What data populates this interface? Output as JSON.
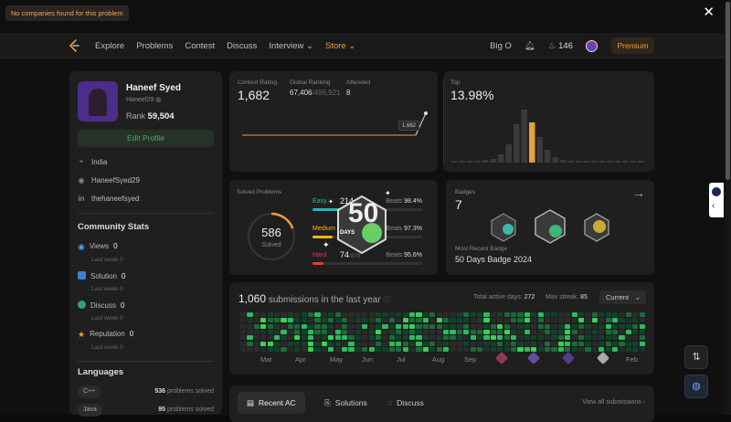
{
  "toast": "No companies found for this problem",
  "nav": {
    "items": [
      "Explore",
      "Problems",
      "Contest",
      "Discuss",
      "Interview",
      "Store"
    ],
    "bigo": "Big O",
    "streak": "146",
    "premium": "Premium"
  },
  "profile": {
    "name": "Haneef Syed",
    "handle": "Haneef29",
    "rank_label": "Rank",
    "rank": "59,504",
    "edit": "Edit Profile",
    "location": "India",
    "github": "HaneefSyed29",
    "linkedin": "thehaneefsyed"
  },
  "community": {
    "title": "Community Stats",
    "stats": [
      {
        "label": "Views",
        "value": "0",
        "sub": "Last week 0"
      },
      {
        "label": "Solution",
        "value": "0",
        "sub": "Last week 0"
      },
      {
        "label": "Discuss",
        "value": "0",
        "sub": "Last week 0"
      },
      {
        "label": "Reputation",
        "value": "0",
        "sub": "Last week 0"
      }
    ]
  },
  "languages": {
    "title": "Languages",
    "items": [
      {
        "name": "C++",
        "count": "536",
        "suffix": "problems solved"
      },
      {
        "name": "Java",
        "count": "95",
        "suffix": "problems solved"
      }
    ]
  },
  "contest": {
    "rating_label": "Contest Rating",
    "rating": "1,682",
    "global_label": "Global Ranking",
    "global_rank": "67,406",
    "global_total": "/496,921",
    "attended_label": "Attended",
    "attended": "8",
    "tooltip": "1,682",
    "top_label": "Top",
    "top_value": "13.98%"
  },
  "solved": {
    "label": "Solved Problems",
    "count": "586",
    "sub": "Solved",
    "rows": [
      {
        "name": "Easy",
        "count": "214",
        "beats_label": "Beats",
        "beats": "98.4%",
        "color": "#1cbaba",
        "fill": 0.25
      },
      {
        "name": "Medium",
        "count": "298",
        "beats_label": "Beats",
        "beats": "97.3%",
        "color": "#ffb700",
        "fill": 0.18
      },
      {
        "name": "Hard",
        "count": "74",
        "total": "/876",
        "beats_label": "Beats",
        "beats": "95.6%",
        "color": "#f63737",
        "fill": 0.1
      }
    ]
  },
  "badges": {
    "label": "Badges",
    "count": "7",
    "recent_label": "Most Recent Badge",
    "recent": "50 Days Badge 2024",
    "big_badge": "50",
    "big_badge_sub": "DAYS"
  },
  "submissions": {
    "count": "1,060",
    "title": "submissions in the last year",
    "active_label": "Total active days:",
    "active": "272",
    "streak_label": "Max streak:",
    "streak": "85",
    "dropdown": "Current",
    "months": [
      "Mar",
      "Apr",
      "May",
      "Jun",
      "Jul",
      "Aug",
      "Sep",
      "Feb"
    ]
  },
  "tabs": {
    "items": [
      "Recent AC",
      "Solutions",
      "Discuss"
    ],
    "view_all": "View all submissions"
  },
  "colors": {
    "accent": "#e7a03c",
    "green": "#2cbb5d",
    "card": "#1f1f1f"
  }
}
